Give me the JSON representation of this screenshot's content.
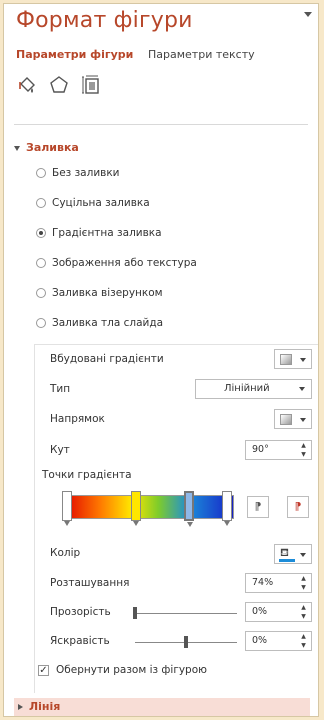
{
  "pane": {
    "title": "Формат фігури",
    "tabs": [
      "Параметри фігури",
      "Параметри тексту"
    ],
    "category_icons": [
      "fill-line-icon",
      "effects-icon",
      "size-properties-icon"
    ]
  },
  "fill": {
    "heading": "Заливка",
    "options": [
      {
        "label": "Без заливки",
        "selected": false
      },
      {
        "label": "Суцільна заливка",
        "selected": false
      },
      {
        "label": "Градієнтна заливка",
        "selected": true
      },
      {
        "label": "Зображення або текстура",
        "selected": false
      },
      {
        "label": "Заливка візерунком",
        "selected": false
      },
      {
        "label": "Заливка тла слайда",
        "selected": false
      }
    ],
    "preset_label": "Вбудовані градієнти",
    "type_label": "Тип",
    "type_value": "Лінійний",
    "direction_label": "Напрямок",
    "angle_label": "Кут",
    "angle_value": "90°",
    "stops_label": "Точки градієнта",
    "stops": [
      {
        "position": 0.03,
        "color": "#ffffff"
      },
      {
        "position": 0.43,
        "color": "#ffe600"
      },
      {
        "position": 0.74,
        "color": "#8fb8e8"
      },
      {
        "position": 0.96,
        "color": "#ffffff"
      }
    ],
    "color_label": "Колір",
    "color_value": "#1c8cd8",
    "position_label": "Розташування",
    "position_value": "74%",
    "transparency_label": "Прозорість",
    "transparency_value": "0%",
    "transparency_level": 0,
    "brightness_label": "Яскравість",
    "brightness_value": "0%",
    "brightness_level": 0.5,
    "rotate_label": "Обернути разом із фігурою",
    "rotate_checked": true
  },
  "line": {
    "heading": "Лінія"
  }
}
